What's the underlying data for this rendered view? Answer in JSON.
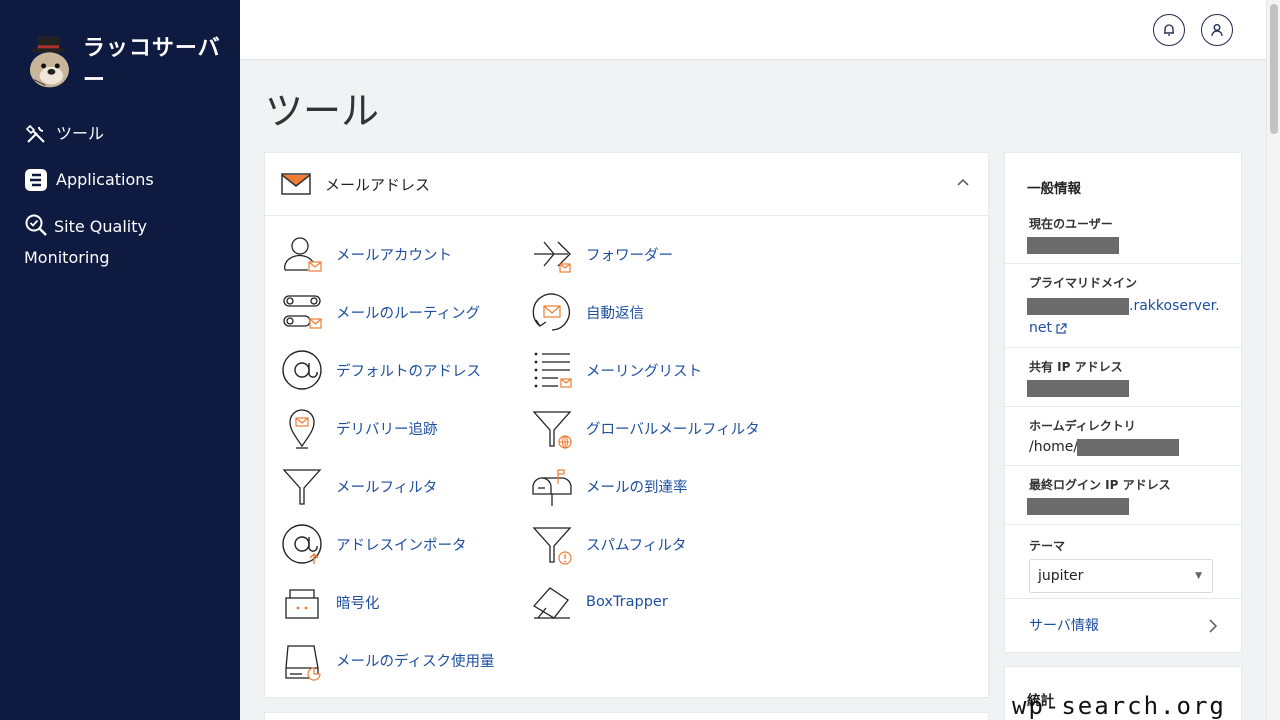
{
  "brand": {
    "name": "ラッコサーバー"
  },
  "sidebar": {
    "items": [
      {
        "label": "ツール",
        "icon": "tools-icon"
      },
      {
        "label": "Applications",
        "icon": "applications-icon"
      },
      {
        "label": "Site Quality Monitoring",
        "icon": "site-quality-icon"
      }
    ]
  },
  "page": {
    "title": "ツール"
  },
  "email_section": {
    "title": "メールアドレス",
    "tools_left": [
      "メールアカウント",
      "メールのルーティング",
      "デフォルトのアドレス",
      "デリバリー追跡",
      "メールフィルタ",
      "アドレスインポータ",
      "暗号化",
      "メールのディスク使用量"
    ],
    "tools_right": [
      "フォワーダー",
      "自動返信",
      "メーリングリスト",
      "グローバルメールフィルタ",
      "メールの到達率",
      "スパムフィルタ",
      "BoxTrapper"
    ]
  },
  "info": {
    "title": "一般情報",
    "current_user_label": "現在のユーザー",
    "primary_domain_label": "プライマリドメイン",
    "primary_domain_suffix": ".rakkoserver.",
    "primary_domain_suffix2": "net",
    "shared_ip_label": "共有 IP アドレス",
    "home_dir_label": "ホームディレクトリ",
    "home_dir_prefix": "/home/",
    "last_login_label": "最終ログイン IP アドレス",
    "theme_label": "テーマ",
    "theme_value": "jupiter",
    "server_info_label": "サーバ情報"
  },
  "stats": {
    "title": "統計"
  },
  "watermark": "wp-search.org",
  "colors": {
    "sidebar_bg": "#0e1a40",
    "link": "#1e4fa0",
    "accent": "#f07c33"
  }
}
